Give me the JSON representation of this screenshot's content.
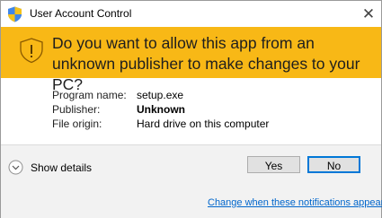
{
  "window": {
    "title": "User Account Control",
    "close_glyph": "✕",
    "title_icon": "uac-shield-icon"
  },
  "banner": {
    "question": "Do you want to allow this app from an unknown publisher to make changes to your PC?",
    "icon": "warning-shield-icon",
    "background_color": "#f8b816"
  },
  "details": {
    "rows": [
      {
        "label": "Program name:",
        "value": "setup.exe"
      },
      {
        "label": "Publisher:",
        "value": "Unknown"
      },
      {
        "label": "File origin:",
        "value": "Hard drive on this computer"
      }
    ]
  },
  "footer": {
    "show_details_label": "Show details",
    "yes_label": "Yes",
    "no_label": "No",
    "link_label": "Change when these notifications appear"
  }
}
